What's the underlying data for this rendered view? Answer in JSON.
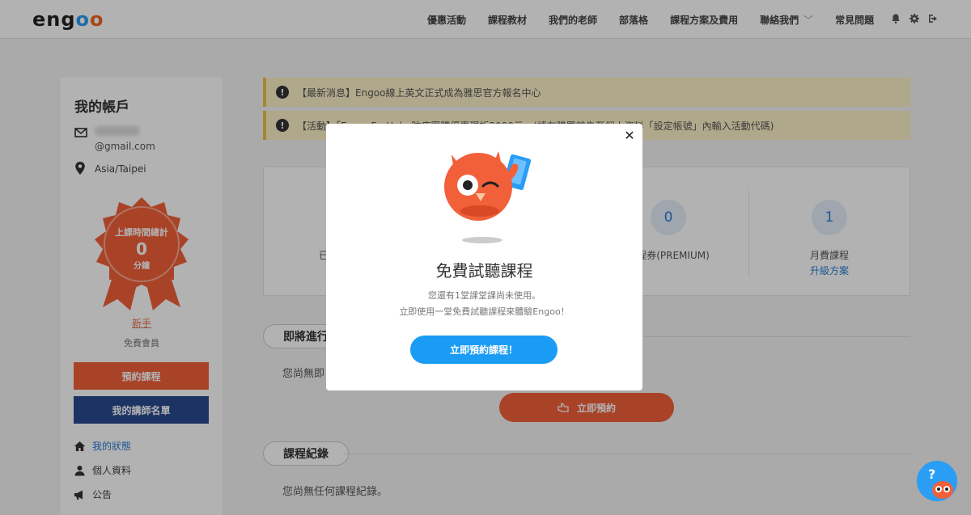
{
  "header": {
    "logo": {
      "e": "eng",
      "o1": "o",
      "o2": "o"
    },
    "nav": [
      "優惠活動",
      "課程教材",
      "我們的老師",
      "部落格",
      "課程方案及費用",
      "聯絡我們",
      "常見問題"
    ],
    "nav_dropdown_indicator": "﹀"
  },
  "sidebar": {
    "title": "我的帳戶",
    "email": "@gmail.com",
    "timezone": "Asia/Taipei",
    "badge": {
      "label": "上課時間總計",
      "value": "0",
      "unit": "分鐘"
    },
    "level": "新手",
    "membership": "免費會員",
    "book_button": "預約課程",
    "tutors_button": "我的講師名單",
    "menu": [
      "我的狀態",
      "個人資料",
      "公告"
    ]
  },
  "notices": [
    "【最新消息】Engoo線上英文正式成為雅思官方報名中心",
    "【活動】「EngooForHelp 防疫團購優惠現折2000元」(請在購買前先至個人資料「設定帳號」內輸入活動代碼)"
  ],
  "stats": [
    {
      "value": "",
      "label": "已"
    },
    {
      "value": "",
      "label": ""
    },
    {
      "value": "0",
      "label": "課程券(PREMIUM)"
    },
    {
      "value": "1",
      "label": "月費課程",
      "link": "升級方案"
    }
  ],
  "sections": {
    "upcoming": {
      "title": "即將進行",
      "empty": "您尚無即",
      "button": "立即預約"
    },
    "history": {
      "title": "課程紀錄",
      "empty": "您尚無任何課程紀錄。"
    }
  },
  "modal": {
    "title": "免費試聽課程",
    "line1": "您還有1堂課堂課尚未使用。",
    "line2": "立即使用一堂免費試聽課程來體驗Engoo！",
    "button": "立即預約課程！",
    "close": "✕"
  },
  "help": {
    "label": "?"
  },
  "colors": {
    "accent_orange": "#f2603a",
    "navy": "#2a4a8f",
    "blue": "#1a9cf5",
    "notice_bg": "#fdf1c8"
  }
}
